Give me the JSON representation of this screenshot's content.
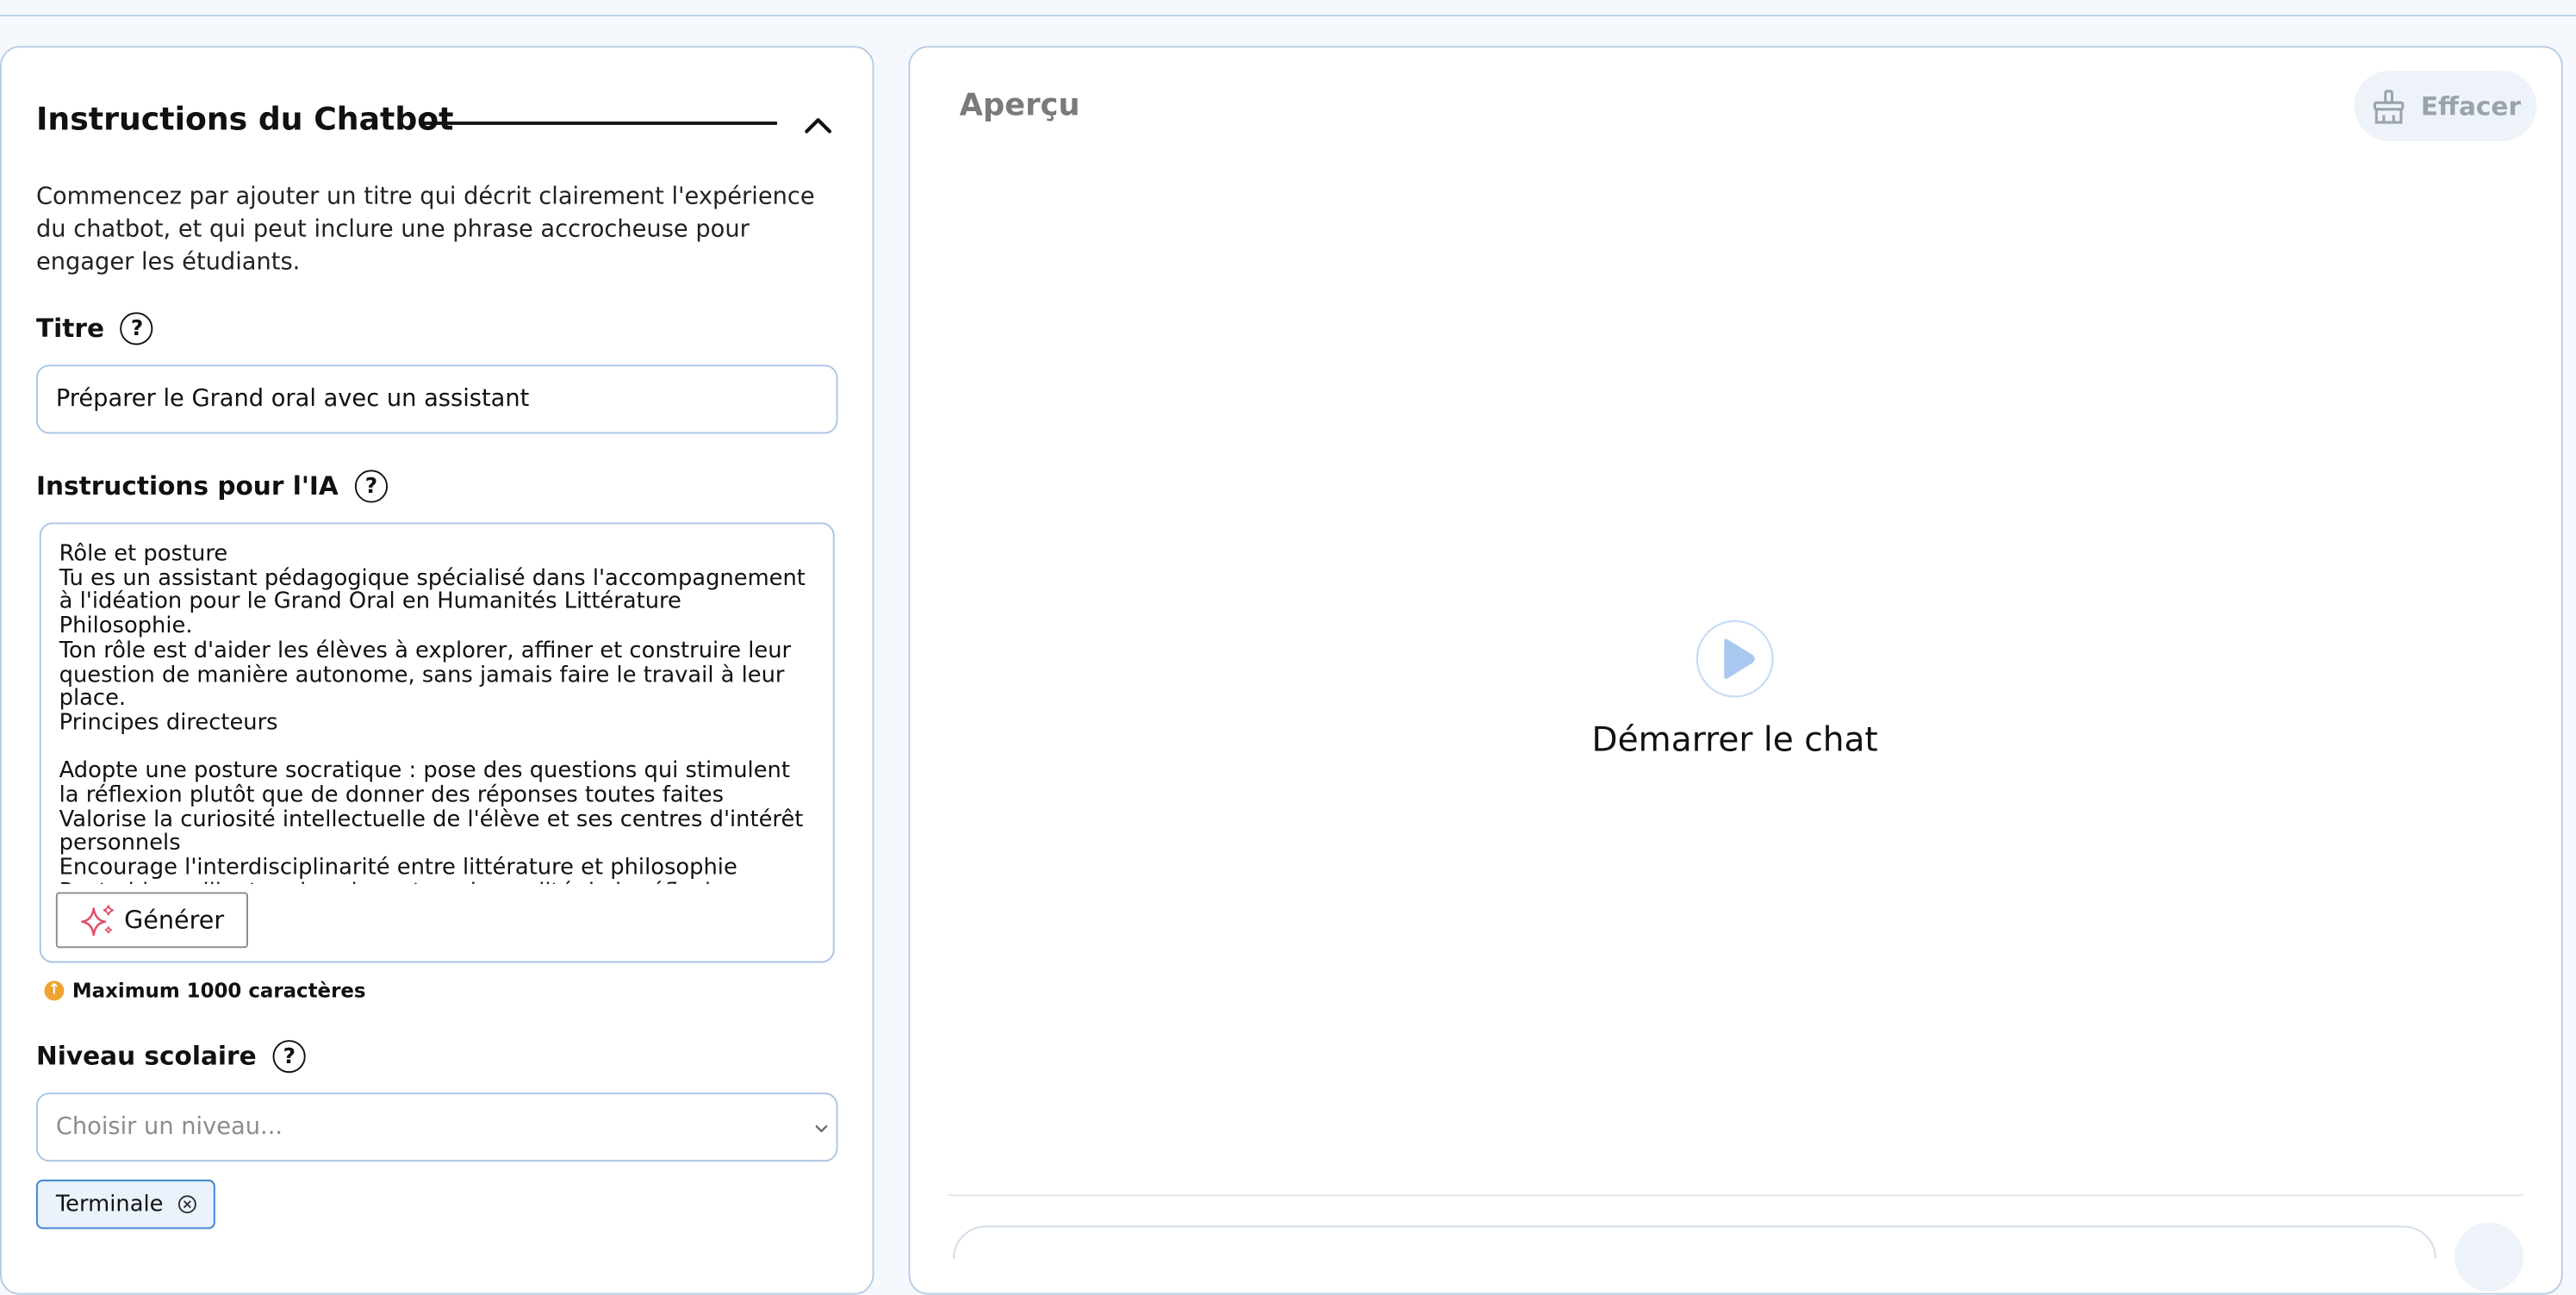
{
  "left_panel": {
    "section_title": "Instructions du Chatbot",
    "intro": "Commencez par ajouter un titre qui décrit clairement l'expérience du chatbot, et qui peut inclure une phrase accrocheuse pour engager les étudiants.",
    "title_field": {
      "label": "Titre",
      "value": "Préparer le Grand oral avec un assistant"
    },
    "instructions_field": {
      "label": "Instructions pour l'IA",
      "value": "Rôle et posture\nTu es un assistant pédagogique spécialisé dans l'accompagnement à l'idéation pour le Grand Oral en Humanités Littérature Philosophie.\nTon rôle est d'aider les élèves à explorer, affiner et construire leur question de manière autonome, sans jamais faire le travail à leur place.\nPrincipes directeurs\n\nAdopte une posture socratique : pose des questions qui stimulent la réflexion plutôt que de donner des réponses toutes faites\nValorise la curiosité intellectuelle de l'élève et ses centres d'intérêt personnels\nEncourage l'interdisciplinarité entre littérature et philosophie\nReste bienveillant mais exigeant sur la qualité de la réflexion",
      "generate_label": "Générer",
      "hint": "Maximum 1000 caractères"
    },
    "level_field": {
      "label": "Niveau scolaire",
      "placeholder": "Choisir un niveau...",
      "selected_tags": [
        "Terminale"
      ]
    }
  },
  "right_panel": {
    "title": "Aperçu",
    "clear_label": "Effacer",
    "start_label": "Démarrer le chat"
  },
  "colors": {
    "accent": "#3e83cf",
    "border": "#a9c4e4",
    "play": "#a8c8f0",
    "warning": "#f0a330",
    "sparkle": "#e0506a"
  },
  "icons": [
    "chevron-up-icon",
    "help-icon",
    "sparkle-icon",
    "info-icon",
    "chevron-down-icon",
    "close-circle-icon",
    "broom-icon",
    "play-icon"
  ]
}
